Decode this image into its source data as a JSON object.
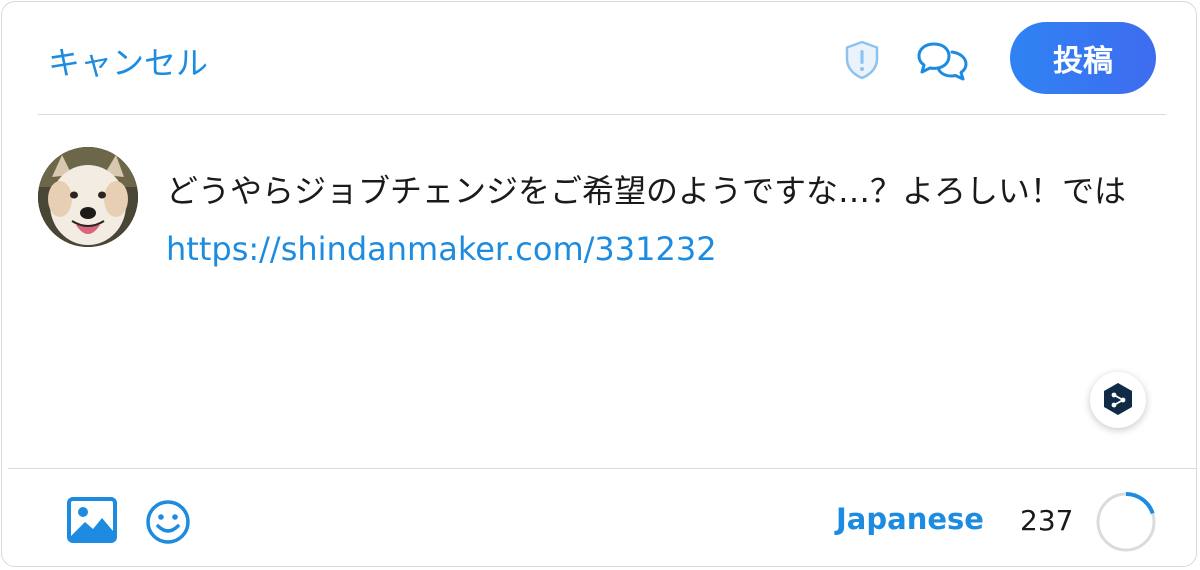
{
  "header": {
    "cancel_label": "キャンセル",
    "post_label": "投稿",
    "icons": [
      "shield-alert-icon",
      "chat-bubbles-icon"
    ]
  },
  "compose": {
    "text": "どうやらジョブチェンジをご希望のようですな…？よろしい！では ",
    "link": "https://shindanmaker.com/331232"
  },
  "footer": {
    "language": "Japanese",
    "remaining_count": "237",
    "char_progress_fraction": 0.2,
    "icons": [
      "image-icon",
      "emoji-icon",
      "deepl-icon"
    ]
  },
  "colors": {
    "accent": "#1d8ce0",
    "post_gradient_start": "#2f83f3",
    "post_gradient_end": "#3e6cf0",
    "divider": "#d9dbe1",
    "text": "#1a1a1a"
  }
}
